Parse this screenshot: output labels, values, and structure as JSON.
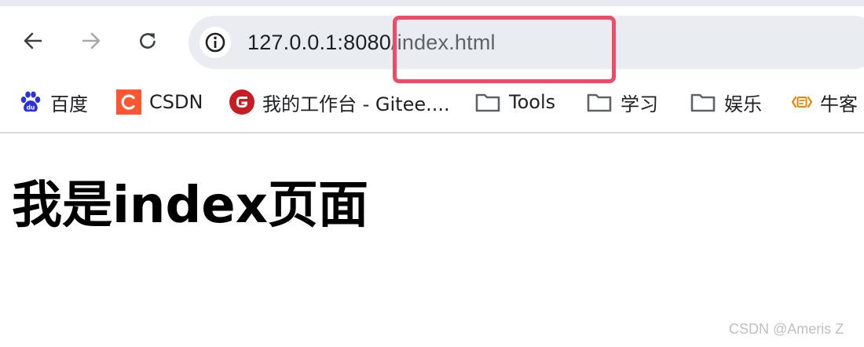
{
  "browser": {
    "address_bar": {
      "url_host": "127.0.0.1:8080",
      "url_path": "/index.html"
    },
    "highlight_color": "#ef4b66",
    "bookmarks": [
      {
        "label": "百度",
        "icon": "baidu-icon"
      },
      {
        "label": "CSDN",
        "icon": "csdn-icon"
      },
      {
        "label": "我的工作台 - Gitee....",
        "icon": "gitee-icon"
      },
      {
        "label": "Tools",
        "icon": "folder-icon"
      },
      {
        "label": "学习",
        "icon": "folder-icon"
      },
      {
        "label": "娱乐",
        "icon": "folder-icon"
      },
      {
        "label": "牛客",
        "icon": "nowcoder-icon"
      }
    ]
  },
  "page": {
    "heading": "我是index页面"
  },
  "watermark": "CSDN @Ameris Z"
}
